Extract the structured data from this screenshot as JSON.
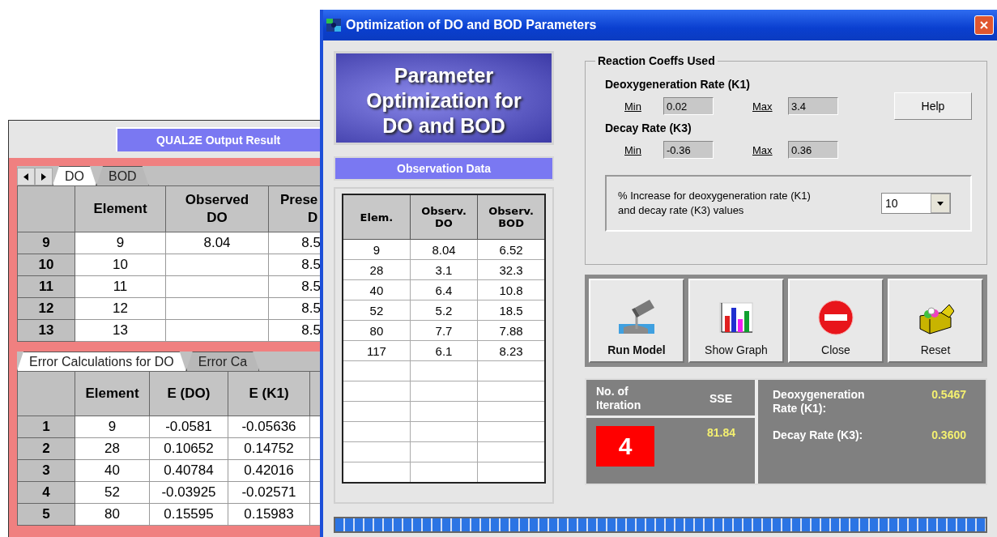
{
  "back_window": {
    "header": "QUAL2E Output Result",
    "top_tabs": [
      {
        "label": "DO",
        "selected": true
      },
      {
        "label": "BOD",
        "selected": false
      }
    ],
    "top_table": {
      "columns": [
        "Element",
        "Observed DO",
        "Prese D"
      ],
      "rows": [
        {
          "header": "9",
          "cells": [
            "9",
            "8.04",
            "8.5"
          ]
        },
        {
          "header": "10",
          "cells": [
            "10",
            "",
            "8.5"
          ]
        },
        {
          "header": "11",
          "cells": [
            "11",
            "",
            "8.5"
          ]
        },
        {
          "header": "12",
          "cells": [
            "12",
            "",
            "8.5"
          ]
        },
        {
          "header": "13",
          "cells": [
            "13",
            "",
            "8.5"
          ]
        }
      ]
    },
    "bottom_tabs": [
      {
        "label": "Error Calculations for DO",
        "selected": true
      },
      {
        "label": "Error Ca",
        "selected": false
      }
    ],
    "bottom_table": {
      "columns": [
        "Element",
        "E (DO)",
        "E (K1)"
      ],
      "rows": [
        {
          "header": "1",
          "cells": [
            "9",
            "-0.0581",
            "-0.05636"
          ]
        },
        {
          "header": "2",
          "cells": [
            "28",
            "0.10652",
            "0.14752"
          ]
        },
        {
          "header": "3",
          "cells": [
            "40",
            "0.40784",
            "0.42016"
          ]
        },
        {
          "header": "4",
          "cells": [
            "52",
            "-0.03925",
            "-0.02571"
          ]
        },
        {
          "header": "5",
          "cells": [
            "80",
            "0.15595",
            "0.15983"
          ]
        }
      ]
    }
  },
  "dialog": {
    "title": "Optimization of DO and BOD Parameters",
    "banner": "Parameter Optimization for DO and BOD",
    "observation_title": "Observation Data",
    "observation_table": {
      "columns": [
        "Elem.",
        "Observ. DO",
        "Observ. BOD"
      ],
      "rows": [
        [
          "9",
          "8.04",
          "6.52"
        ],
        [
          "28",
          "3.1",
          "32.3"
        ],
        [
          "40",
          "6.4",
          "10.8"
        ],
        [
          "52",
          "5.2",
          "18.5"
        ],
        [
          "80",
          "7.7",
          "7.88"
        ],
        [
          "117",
          "6.1",
          "8.23"
        ]
      ]
    },
    "reaction_coeffs": {
      "title": "Reaction Coeffs Used",
      "groups": [
        {
          "label": "Deoxygeneration Rate (K1)",
          "min_label": "Min",
          "min": "0.02",
          "max_label": "Max",
          "max": "3.4"
        },
        {
          "label": "Decay Rate (K3)",
          "min_label": "Min",
          "min": "-0.36",
          "max_label": "Max",
          "max": "0.36"
        }
      ],
      "help_button": "Help",
      "increase": {
        "label": "% Increase for deoxygeneration rate (K1) and decay rate (K3) values",
        "value": "10"
      }
    },
    "actions": [
      {
        "label": "Run Model",
        "kind": "run",
        "default": true
      },
      {
        "label": "Show Graph",
        "kind": "graph",
        "default": false
      },
      {
        "label": "Close",
        "kind": "close",
        "default": false
      },
      {
        "label": "Reset",
        "kind": "reset",
        "default": false
      }
    ],
    "results": {
      "iteration_label": "No. of Iteration",
      "iteration": "4",
      "sse_label": "SSE",
      "sse": "81.84",
      "rates": [
        {
          "label": "Deoxygeneration Rate (K1):",
          "value": "0.5467"
        },
        {
          "label": "Decay Rate (K3):",
          "value": "0.3600"
        }
      ]
    },
    "progress": {
      "level": 1
    }
  }
}
